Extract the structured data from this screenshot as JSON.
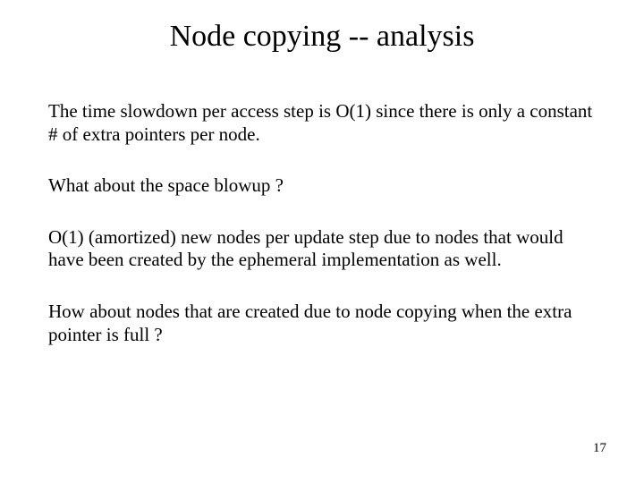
{
  "title": "Node copying -- analysis",
  "paragraphs": [
    "The time slowdown per access step is O(1) since there is only a constant # of extra pointers per node.",
    "What about the space blowup ?",
    "O(1) (amortized) new nodes per update step due to nodes that would have been created by the ephemeral implementation as well.",
    "How about nodes that are created due to node copying when the extra pointer is full ?"
  ],
  "pageNumber": "17"
}
